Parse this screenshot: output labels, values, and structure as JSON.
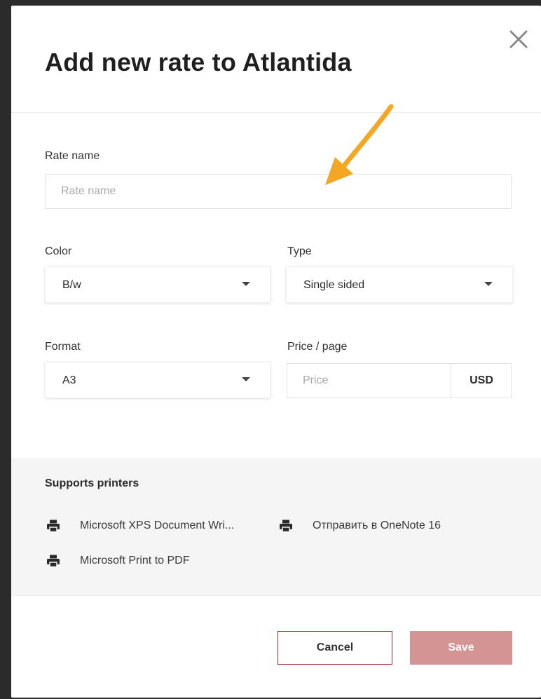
{
  "dialog": {
    "title": "Add new rate to Atlantida"
  },
  "form": {
    "rate_name": {
      "label": "Rate name",
      "placeholder": "Rate name",
      "value": ""
    },
    "color": {
      "label": "Color",
      "selected": "B/w"
    },
    "type": {
      "label": "Type",
      "selected": "Single sided"
    },
    "format": {
      "label": "Format",
      "selected": "A3"
    },
    "price": {
      "label": "Price / page",
      "placeholder": "Price",
      "value": "",
      "currency": "USD"
    }
  },
  "printers": {
    "title": "Supports printers",
    "items": [
      {
        "name": "Microsoft XPS Document Wri...",
        "icon": "printer-icon"
      },
      {
        "name": "Отправить в OneNote 16",
        "icon": "printer-icon"
      },
      {
        "name": "Microsoft Print to PDF",
        "icon": "printer-icon"
      }
    ]
  },
  "footer": {
    "cancel_label": "Cancel",
    "save_label": "Save"
  },
  "colors": {
    "accent_border": "#9b2d30",
    "save_disabled_bg": "#d49494",
    "annotation_arrow": "#f5a623",
    "printers_bg": "#f5f5f5"
  },
  "icons": {
    "close": "close-icon",
    "caret": "chevron-down-icon",
    "printer": "printer-icon",
    "annotation": "arrow-annotation"
  }
}
